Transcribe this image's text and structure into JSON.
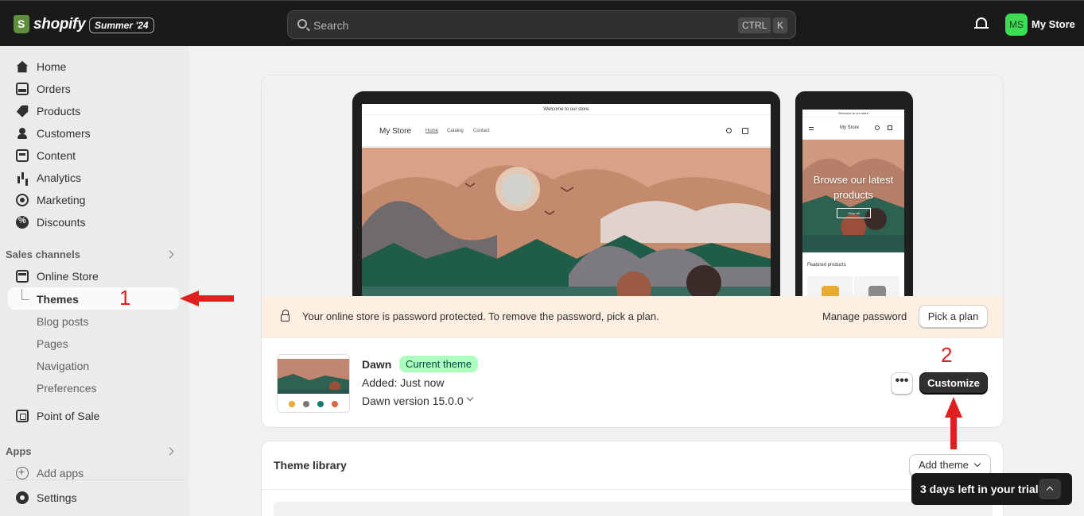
{
  "topbar": {
    "logo_text": "shopify",
    "edition_badge": "Summer '24",
    "search_placeholder": "Search",
    "shortcut_ctrl": "CTRL",
    "shortcut_k": "K",
    "avatar_initials": "MS",
    "store_name": "My Store"
  },
  "sidebar": {
    "items": [
      {
        "label": "Home"
      },
      {
        "label": "Orders"
      },
      {
        "label": "Products"
      },
      {
        "label": "Customers"
      },
      {
        "label": "Content"
      },
      {
        "label": "Analytics"
      },
      {
        "label": "Marketing"
      },
      {
        "label": "Discounts"
      }
    ],
    "sales_channels_label": "Sales channels",
    "online_store_label": "Online Store",
    "online_store_sub": [
      "Themes",
      "Blog posts",
      "Pages",
      "Navigation",
      "Preferences"
    ],
    "point_of_sale_label": "Point of Sale",
    "apps_label": "Apps",
    "add_apps_label": "Add apps",
    "settings_label": "Settings"
  },
  "preview": {
    "announcement": "Welcome to our store",
    "store_name": "My Store",
    "nav_links": [
      "Home",
      "Catalog",
      "Contact"
    ],
    "mobile_hero_title": "Browse our latest products",
    "mobile_shop_all": "Shop all",
    "featured_products": "Featured products"
  },
  "banner": {
    "message": "Your online store is password protected. To remove the password, pick a plan.",
    "manage_password": "Manage password",
    "pick_plan": "Pick a plan"
  },
  "current_theme": {
    "name": "Dawn",
    "badge": "Current theme",
    "added": "Added: Just now",
    "version": "Dawn version 15.0.0",
    "more_label": "•••",
    "customize_label": "Customize"
  },
  "theme_library": {
    "title": "Theme library",
    "add_theme_label": "Add theme"
  },
  "trial": {
    "text": "3 days left in your trial"
  },
  "annotations": {
    "step1": "1",
    "step2": "2"
  },
  "colors": {
    "topbar_bg": "#1a1a1a",
    "sidebar_bg": "#ebebeb",
    "badge_green": "#affebf",
    "banner_bg": "#fcefe1",
    "avatar_green": "#3ddc55",
    "annotation_red": "#e02020"
  }
}
